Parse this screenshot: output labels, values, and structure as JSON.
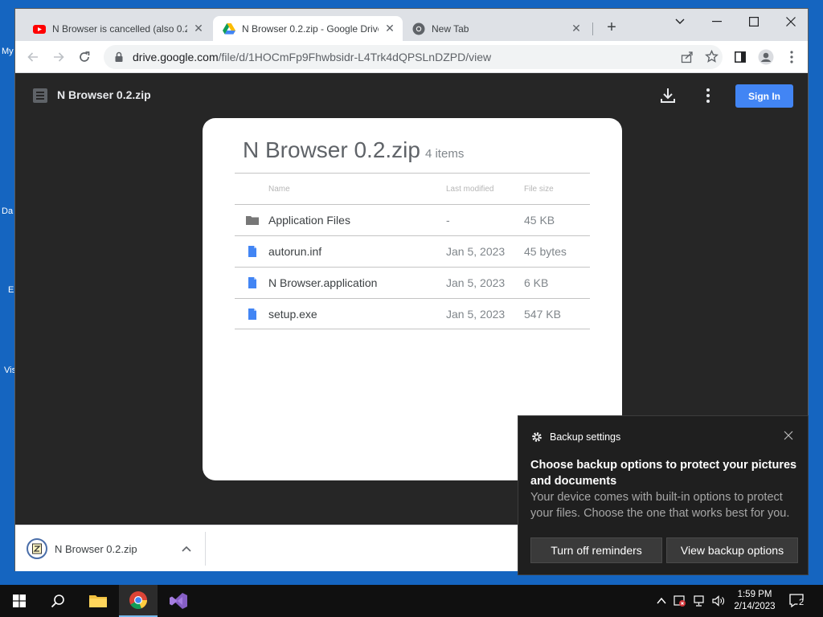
{
  "browser": {
    "tabs": [
      {
        "title": "N Browser is cancelled (also 0.2",
        "favicon": "youtube-icon"
      },
      {
        "title": "N Browser 0.2.zip - Google Drive",
        "favicon": "google-drive-icon"
      },
      {
        "title": "New Tab",
        "favicon": "chrome-icon"
      }
    ],
    "url_host": "drive.google.com",
    "url_path": "/file/d/1HOCmFp9Fhwbsidr-L4Trk4dQPSLnDZPD/view"
  },
  "viewer": {
    "file_title": "N Browser 0.2.zip",
    "sign_in": "Sign In",
    "zip_name": "N Browser 0.2.zip",
    "item_count": "4 items",
    "columns": {
      "name": "Name",
      "modified": "Last modified",
      "size": "File size"
    },
    "files": [
      {
        "name": "Application Files",
        "modified": "-",
        "size": "45 KB",
        "icon": "folder-icon"
      },
      {
        "name": "autorun.inf",
        "modified": "Jan 5, 2023",
        "size": "45 bytes",
        "icon": "doc-icon"
      },
      {
        "name": "N Browser.application",
        "modified": "Jan 5, 2023",
        "size": "6 KB",
        "icon": "doc-icon"
      },
      {
        "name": "setup.exe",
        "modified": "Jan 5, 2023",
        "size": "547 KB",
        "icon": "doc-icon"
      }
    ]
  },
  "download_shelf": {
    "item": "N Browser 0.2.zip"
  },
  "toast": {
    "source": "Backup settings",
    "title": "Choose backup options to protect your pictures and documents",
    "body": "Your device comes with built-in options to protect your files. Choose the one that works best for you.",
    "btn_turn_off": "Turn off reminders",
    "btn_view": "View backup options"
  },
  "desktop_fragments": [
    "My",
    "Da",
    "E",
    "Vis"
  ],
  "taskbar": {
    "time": "1:59 PM",
    "date": "2/14/2023",
    "notifications": "2"
  },
  "colors": {
    "accent": "#4285f4",
    "desktop": "#1565c0",
    "viewer_bg": "#262626"
  }
}
